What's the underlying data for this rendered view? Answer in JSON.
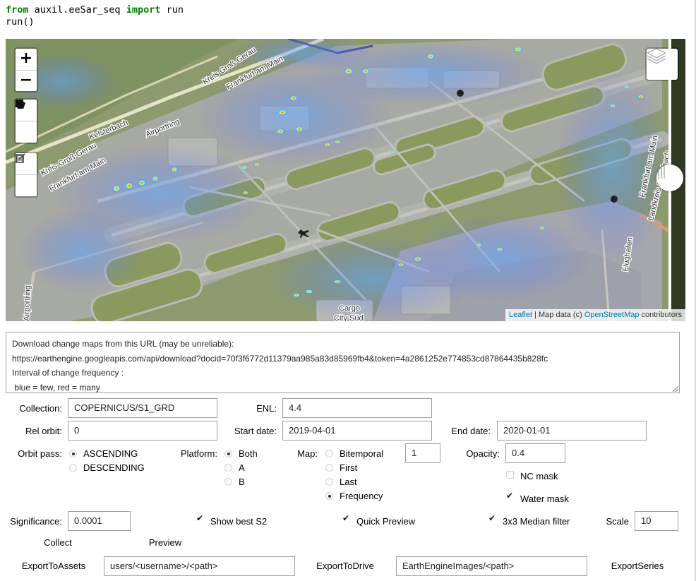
{
  "code": {
    "line1_kw1": "from",
    "line1_mod": " auxil.eeSar_seq ",
    "line1_kw2": "import",
    "line1_name": " run",
    "line2": "run()"
  },
  "map": {
    "zoom_in": "+",
    "zoom_out": "−",
    "labels": {
      "kreis_top": "Kreis Groß-Gerau",
      "frankfurt_top": "Frankfurt am Main",
      "kelsterbach": "Kelsterbach",
      "airportring": "Airportring",
      "kreis_left": "Kreis Groß-Gerau",
      "frankfurt_left": "Frankfurt am Main",
      "cargo": "Cargo",
      "city_sud": "City Süd",
      "flughafen": "Flughafen",
      "frankfurt_right": "Frankfurt am Main",
      "landkreis": "Landkreis Offenbach",
      "airportring_left": "Airportring"
    },
    "attribution": {
      "leaflet": "Leaflet",
      "sep": " | Map data (c) ",
      "osm": "OpenStreetMap",
      "contrib": " contributors"
    }
  },
  "output": {
    "line1": "Download change maps from this URL (may be unreliable):",
    "line2": "https://earthengine.googleapis.com/api/download?docid=70f3f6772d11379aa985a83d85969fb4&token=4a2861252e774853cd87864435b828fc",
    "line3": "Interval of change frequency :",
    "line4": " blue = few, red = many"
  },
  "form": {
    "collection_label": "Collection:",
    "collection_value": "COPERNICUS/S1_GRD",
    "enl_label": "ENL:",
    "enl_value": "4.4",
    "relorbit_label": "Rel orbit:",
    "relorbit_value": "0",
    "startdate_label": "Start date:",
    "startdate_value": "2019-04-01",
    "enddate_label": "End date:",
    "enddate_value": "2020-01-01",
    "orbitpass_label": "Orbit pass:",
    "orbitpass_options": [
      "ASCENDING",
      "DESCENDING"
    ],
    "orbitpass_selected": "ASCENDING",
    "platform_label": "Platform:",
    "platform_options": [
      "Both",
      "A",
      "B"
    ],
    "platform_selected": "Both",
    "map_label": "Map:",
    "map_options": [
      "Bitemporal",
      "First",
      "Last",
      "Frequency"
    ],
    "map_selected": "Frequency",
    "map_index_value": "1",
    "opacity_label": "Opacity:",
    "opacity_value": "0.4",
    "ncmask_label": "NC mask",
    "ncmask_checked": false,
    "watermask_label": "Water mask",
    "watermask_checked": true,
    "significance_label": "Significance:",
    "significance_value": "0.0001",
    "showbests2_label": "Show best S2",
    "showbests2_checked": true,
    "quickpreview_label": "Quick Preview",
    "quickpreview_checked": true,
    "medianfilter_label": "3x3 Median filter",
    "medianfilter_checked": true,
    "scale_label": "Scale",
    "scale_value": "10",
    "collect_button": "Collect",
    "preview_button": "Preview",
    "exporttoassets_button": "ExportToAssets",
    "assets_path_value": "users/<username>/<path>",
    "exporttodrive_button": "ExportToDrive",
    "drive_path_value": "EarthEngineImages/<path>",
    "exportseries_button": "ExportSeries"
  }
}
